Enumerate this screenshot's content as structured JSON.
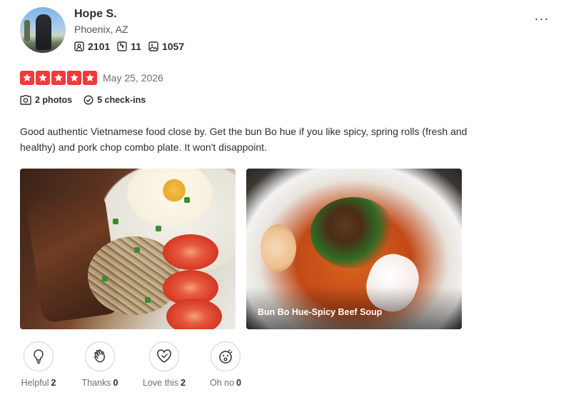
{
  "reviewer": {
    "name": "Hope S.",
    "location": "Phoenix, AZ",
    "stats": {
      "friends": "2101",
      "reviews": "11",
      "photos": "1057"
    }
  },
  "review": {
    "rating": 5,
    "max_rating": 5,
    "date": "May 25, 2026",
    "photos_label": "2 photos",
    "checkins_label": "5 check-ins",
    "text": "Good authentic Vietnamese food close by. Get the bun Bo hue if you like spicy, spring rolls (fresh and healthy) and pork chop combo plate. It won't disappoint."
  },
  "photos": [
    {
      "caption": ""
    },
    {
      "caption": "Bun Bo Hue-Spicy Beef Soup"
    }
  ],
  "reactions": [
    {
      "label": "Helpful",
      "count": "2",
      "icon": "lightbulb-icon"
    },
    {
      "label": "Thanks",
      "count": "0",
      "icon": "clapping-hands-icon"
    },
    {
      "label": "Love this",
      "count": "2",
      "icon": "heart-icon"
    },
    {
      "label": "Oh no",
      "count": "0",
      "icon": "surprised-face-icon"
    }
  ],
  "menu": {
    "more_label": "···"
  },
  "colors": {
    "star_red": "#f43939",
    "text": "#2d2e2f",
    "muted": "#6e7072"
  }
}
